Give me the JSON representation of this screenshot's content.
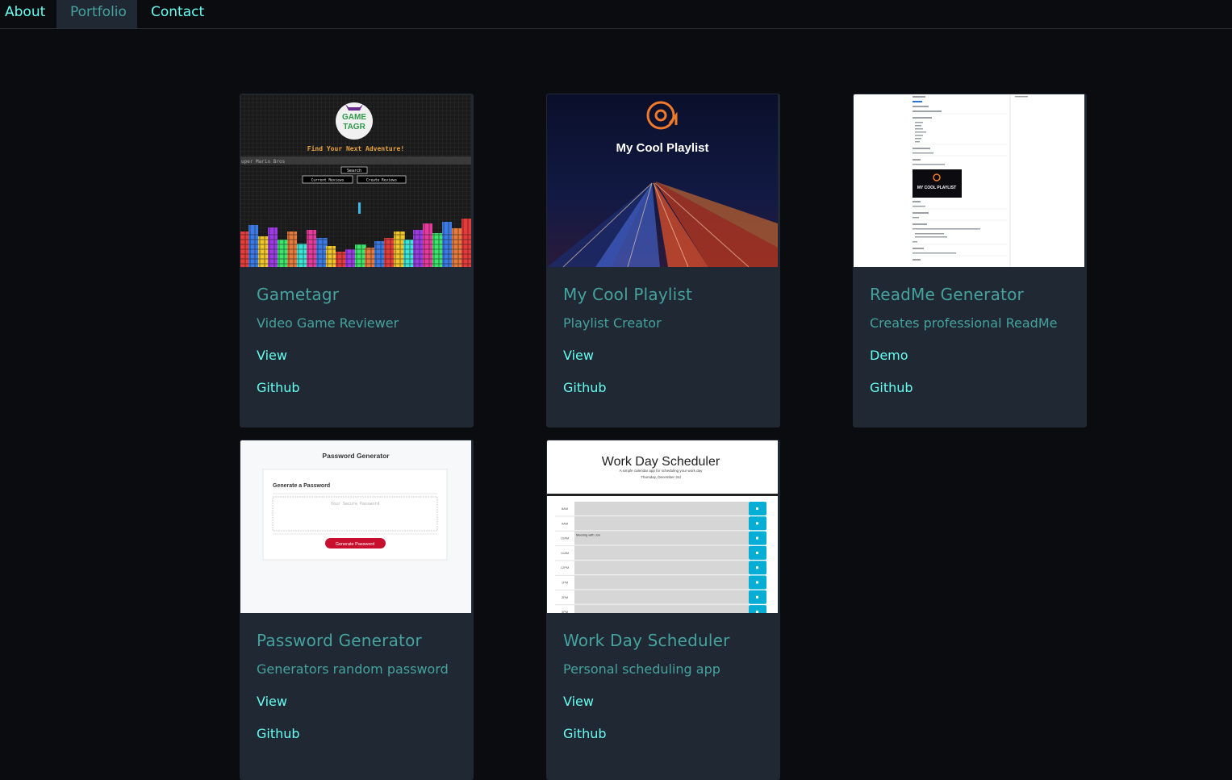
{
  "nav": {
    "items": [
      {
        "label": "About",
        "active": false
      },
      {
        "label": "Portfolio",
        "active": true
      },
      {
        "label": "Contact",
        "active": false
      }
    ]
  },
  "colors": {
    "background": "#0b0c10",
    "card": "#1f2833",
    "accent": "#66fcf1",
    "muted_accent": "#45a29e"
  },
  "projects": [
    {
      "title": "Gametagr",
      "subtitle": "Video Game Reviewer",
      "link1": "View",
      "link2": "Github",
      "screenshot": {
        "logo_top": "GAME",
        "logo_bottom": "TAGR",
        "headline": "Find Your Next Adventure!",
        "search_value": "uper Mario Bros",
        "search_button": "Search",
        "button_a": "Current Reviews",
        "button_b": "Create Reviews"
      }
    },
    {
      "title": "My Cool Playlist",
      "subtitle": "Playlist Creator",
      "link1": "View",
      "link2": "Github",
      "screenshot": {
        "banner": "My Cool Playlist"
      }
    },
    {
      "title": "ReadMe Generator",
      "subtitle": "Creates professional ReadMe",
      "link1": "Demo",
      "link2": "Github",
      "screenshot": {
        "embedded_banner": "MY COOL PLAYLIST"
      }
    },
    {
      "title": "Password Generator",
      "subtitle": "Generators random password",
      "link1": "View",
      "link2": "Github",
      "screenshot": {
        "heading": "Password Generator",
        "card_heading": "Generate a Password",
        "placeholder": "Your Secure Password",
        "button": "Generate Password"
      }
    },
    {
      "title": "Work Day Scheduler",
      "subtitle": "Personal scheduling app",
      "link1": "View",
      "link2": "Github",
      "screenshot": {
        "heading": "Work Day Scheduler",
        "tagline": "A simple calendar app for scheduling your work day",
        "date": "Thursday, December 3rd",
        "hours": [
          "8AM",
          "9AM",
          "10AM",
          "11AM",
          "12PM",
          "1PM",
          "2PM",
          "3PM"
        ],
        "entry": "Meeting with Jon"
      }
    }
  ]
}
